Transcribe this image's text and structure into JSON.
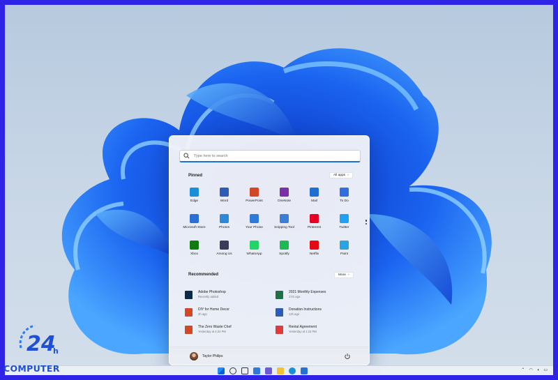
{
  "search": {
    "placeholder": "Type here to search"
  },
  "pinned": {
    "title": "Pinned",
    "all_apps": "All apps",
    "apps": [
      {
        "label": "Edge",
        "icon": "edge-icon",
        "color": "#1a8fd8"
      },
      {
        "label": "Word",
        "icon": "word-icon",
        "color": "#2b5cb8"
      },
      {
        "label": "PowerPoint",
        "icon": "powerpoint-icon",
        "color": "#d24726"
      },
      {
        "label": "OneNote",
        "icon": "onenote-icon",
        "color": "#7b2fa8"
      },
      {
        "label": "Mail",
        "icon": "mail-icon",
        "color": "#1e6fd0"
      },
      {
        "label": "To Do",
        "icon": "todo-icon",
        "color": "#2f6fe0"
      },
      {
        "label": "Microsoft Store",
        "icon": "store-icon",
        "color": "#2a6fd4"
      },
      {
        "label": "Photos",
        "icon": "photos-icon",
        "color": "#2c88d9"
      },
      {
        "label": "Your Phone",
        "icon": "phone-icon",
        "color": "#2f7ad9"
      },
      {
        "label": "Snipping Tool",
        "icon": "snipping-icon",
        "color": "#3a7ed8"
      },
      {
        "label": "Pinterest",
        "icon": "pinterest-icon",
        "color": "#e60023"
      },
      {
        "label": "Twitter",
        "icon": "twitter-icon",
        "color": "#1da1f2"
      },
      {
        "label": "Xbox",
        "icon": "xbox-icon",
        "color": "#107c10"
      },
      {
        "label": "Among Us",
        "icon": "among-us-icon",
        "color": "#3c3c5a"
      },
      {
        "label": "WhatsApp",
        "icon": "whatsapp-icon",
        "color": "#25d366"
      },
      {
        "label": "Spotify",
        "icon": "spotify-icon",
        "color": "#1db954"
      },
      {
        "label": "Netflix",
        "icon": "netflix-icon",
        "color": "#e50914"
      },
      {
        "label": "Paint",
        "icon": "paint-icon",
        "color": "#2aa3e0"
      }
    ]
  },
  "recommended": {
    "title": "Recommended",
    "more": "More",
    "items": [
      {
        "name": "Adobe Photoshop",
        "time": "Recently added",
        "icon": "photoshop-icon",
        "color": "#0b2a4a"
      },
      {
        "name": "2021 Monthly Expenses",
        "time": "17m ago",
        "icon": "excel-icon",
        "color": "#1e7145"
      },
      {
        "name": "DIY for Home Decor",
        "time": "2h ago",
        "icon": "powerpoint-file-icon",
        "color": "#d24726"
      },
      {
        "name": "Donation Instructions",
        "time": "12h ago",
        "icon": "word-file-icon",
        "color": "#2b5cb8"
      },
      {
        "name": "The Zero Waste Chef",
        "time": "Yesterday at 4:24 PM",
        "icon": "powerpoint-file-icon",
        "color": "#d24726"
      },
      {
        "name": "Rental Agreement",
        "time": "Yesterday at 1:15 PM",
        "icon": "pdf-file-icon",
        "color": "#e13a3a"
      }
    ]
  },
  "user": {
    "name": "Taylor Philips"
  },
  "logo": {
    "number": "24",
    "sub": "h",
    "text": "COMPUTER"
  }
}
